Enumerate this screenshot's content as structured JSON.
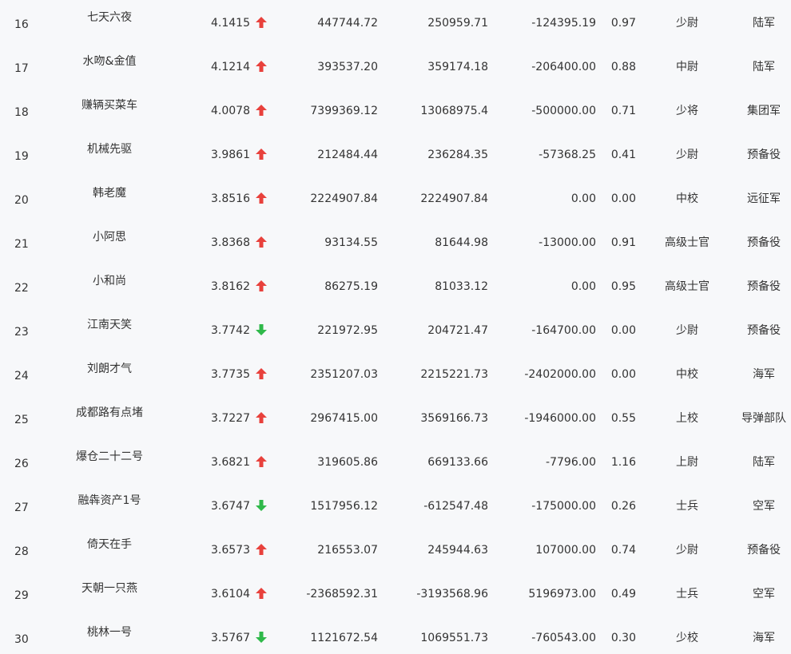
{
  "colors": {
    "background": "#f7f8fa",
    "text": "#333333",
    "up_arrow": "#e8413c",
    "down_arrow": "#2fb94a"
  },
  "rows": [
    {
      "rank": "16",
      "name": "七天六夜",
      "score": "4.1415",
      "trend": "up",
      "value1": "447744.72",
      "value2": "250959.71",
      "value3": "-124395.19",
      "ratio": "0.97",
      "title": "少尉",
      "branch": "陆军"
    },
    {
      "rank": "17",
      "name": "水吻&金值",
      "score": "4.1214",
      "trend": "up",
      "value1": "393537.20",
      "value2": "359174.18",
      "value3": "-206400.00",
      "ratio": "0.88",
      "title": "中尉",
      "branch": "陆军"
    },
    {
      "rank": "18",
      "name": "赚辆买菜车",
      "score": "4.0078",
      "trend": "up",
      "value1": "7399369.12",
      "value2": "13068975.4",
      "value3": "-500000.00",
      "ratio": "0.71",
      "title": "少将",
      "branch": "集团军"
    },
    {
      "rank": "19",
      "name": "机械先驱",
      "score": "3.9861",
      "trend": "up",
      "value1": "212484.44",
      "value2": "236284.35",
      "value3": "-57368.25",
      "ratio": "0.41",
      "title": "少尉",
      "branch": "预备役"
    },
    {
      "rank": "20",
      "name": "韩老魔",
      "score": "3.8516",
      "trend": "up",
      "value1": "2224907.84",
      "value2": "2224907.84",
      "value3": "0.00",
      "ratio": "0.00",
      "title": "中校",
      "branch": "远征军"
    },
    {
      "rank": "21",
      "name": "小阿思",
      "score": "3.8368",
      "trend": "up",
      "value1": "93134.55",
      "value2": "81644.98",
      "value3": "-13000.00",
      "ratio": "0.91",
      "title": "高级士官",
      "branch": "预备役"
    },
    {
      "rank": "22",
      "name": "小和尚",
      "score": "3.8162",
      "trend": "up",
      "value1": "86275.19",
      "value2": "81033.12",
      "value3": "0.00",
      "ratio": "0.95",
      "title": "高级士官",
      "branch": "预备役"
    },
    {
      "rank": "23",
      "name": "江南天笑",
      "score": "3.7742",
      "trend": "down",
      "value1": "221972.95",
      "value2": "204721.47",
      "value3": "-164700.00",
      "ratio": "0.00",
      "title": "少尉",
      "branch": "预备役"
    },
    {
      "rank": "24",
      "name": "刘朗才气",
      "score": "3.7735",
      "trend": "up",
      "value1": "2351207.03",
      "value2": "2215221.73",
      "value3": "-2402000.00",
      "ratio": "0.00",
      "title": "中校",
      "branch": "海军"
    },
    {
      "rank": "25",
      "name": "成都路有点堵",
      "score": "3.7227",
      "trend": "up",
      "value1": "2967415.00",
      "value2": "3569166.73",
      "value3": "-1946000.00",
      "ratio": "0.55",
      "title": "上校",
      "branch": "导弹部队"
    },
    {
      "rank": "26",
      "name": "爆仓二十二号",
      "score": "3.6821",
      "trend": "up",
      "value1": "319605.86",
      "value2": "669133.66",
      "value3": "-7796.00",
      "ratio": "1.16",
      "title": "上尉",
      "branch": "陆军"
    },
    {
      "rank": "27",
      "name": "融犇资产1号",
      "score": "3.6747",
      "trend": "down",
      "value1": "1517956.12",
      "value2": "-612547.48",
      "value3": "-175000.00",
      "ratio": "0.26",
      "title": "士兵",
      "branch": "空军"
    },
    {
      "rank": "28",
      "name": "倚天在手",
      "score": "3.6573",
      "trend": "up",
      "value1": "216553.07",
      "value2": "245944.63",
      "value3": "107000.00",
      "ratio": "0.74",
      "title": "少尉",
      "branch": "预备役"
    },
    {
      "rank": "29",
      "name": "天朝一只燕",
      "score": "3.6104",
      "trend": "up",
      "value1": "-2368592.31",
      "value2": "-3193568.96",
      "value3": "5196973.00",
      "ratio": "0.49",
      "title": "士兵",
      "branch": "空军"
    },
    {
      "rank": "30",
      "name": "桃林一号",
      "score": "3.5767",
      "trend": "down",
      "value1": "1121672.54",
      "value2": "1069551.73",
      "value3": "-760543.00",
      "ratio": "0.30",
      "title": "少校",
      "branch": "海军"
    }
  ]
}
